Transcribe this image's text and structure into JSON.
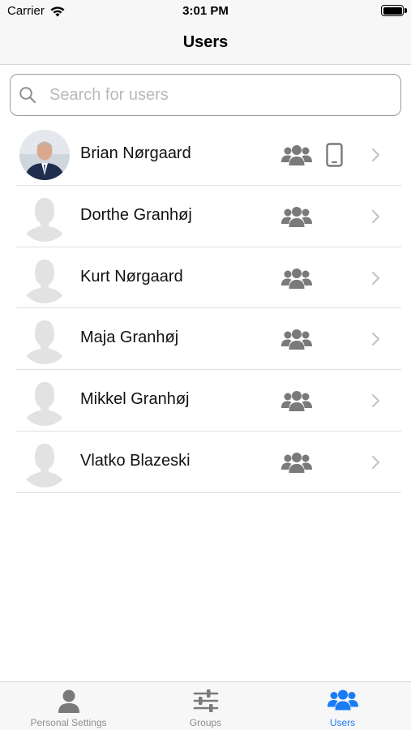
{
  "status_bar": {
    "carrier": "Carrier",
    "time": "3:01 PM"
  },
  "nav": {
    "title": "Users"
  },
  "search": {
    "placeholder": "Search for users",
    "value": ""
  },
  "users": [
    {
      "name": "Brian Nørgaard",
      "avatar": "photo",
      "has_device": true
    },
    {
      "name": "Dorthe Granhøj",
      "avatar": "placeholder-silhouette",
      "has_device": false
    },
    {
      "name": "Kurt Nørgaard",
      "avatar": "placeholder-silhouette",
      "has_device": false
    },
    {
      "name": "Maja Granhøj",
      "avatar": "placeholder-silhouette",
      "has_device": false
    },
    {
      "name": "Mikkel Granhøj",
      "avatar": "placeholder-silhouette",
      "has_device": false
    },
    {
      "name": "Vlatko Blazeski",
      "avatar": "placeholder-silhouette",
      "has_device": false
    }
  ],
  "tabs": [
    {
      "label": "Personal Settings",
      "icon": "person-icon",
      "active": false
    },
    {
      "label": "Groups",
      "icon": "sliders-icon",
      "active": false
    },
    {
      "label": "Users",
      "icon": "users-icon",
      "active": true
    }
  ],
  "colors": {
    "accent": "#1a7cf5",
    "icon_gray": "#7a7a7a",
    "chevron": "#c4c4c7"
  }
}
